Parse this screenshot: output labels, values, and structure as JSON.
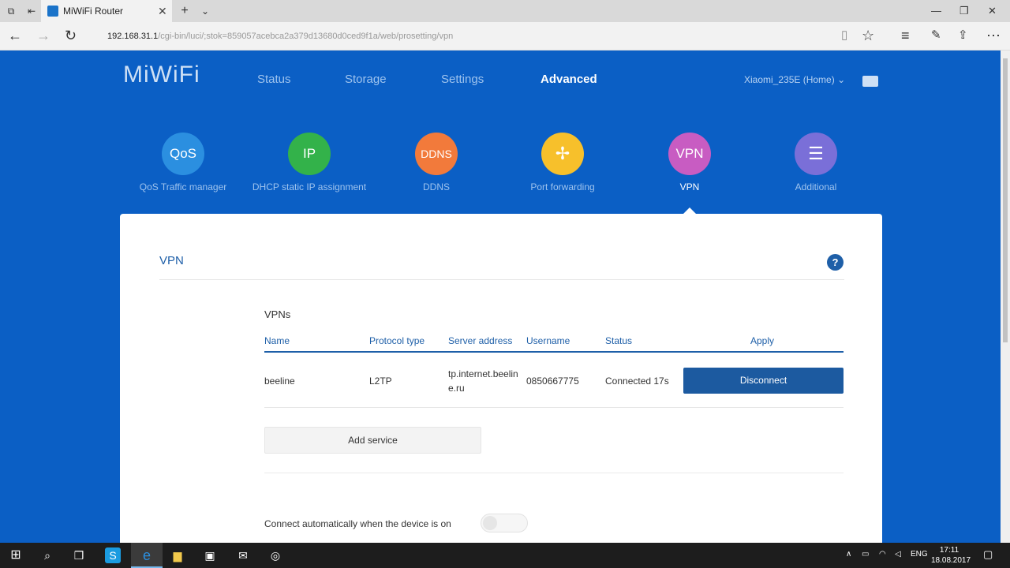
{
  "browser": {
    "tab_title": "MiWiFi Router",
    "url_host": "192.168.31.1",
    "url_path": "/cgi-bin/luci/;stok=859057acebca2a379d13680d0ced9f1a/web/prosetting/vpn"
  },
  "header": {
    "logo": "MiWiFi",
    "nav": [
      "Status",
      "Storage",
      "Settings",
      "Advanced"
    ],
    "active_nav": "Advanced",
    "router_name": "Xiaomi_235E (Home)"
  },
  "features": [
    {
      "icon_text": "QoS",
      "label": "QoS Traffic manager",
      "color": "#2b8fe0"
    },
    {
      "icon_text": "IP",
      "label": "DHCP static IP assignment",
      "color": "#33b24a"
    },
    {
      "icon_text": "DDNS",
      "label": "DDNS",
      "color": "#f27a3b"
    },
    {
      "icon_text": "",
      "label": "Port forwarding",
      "color": "#f7c02b"
    },
    {
      "icon_text": "VPN",
      "label": "VPN",
      "color": "#c85cc2"
    },
    {
      "icon_text": "☰",
      "label": "Additional",
      "color": "#7a6fd8"
    }
  ],
  "panel": {
    "title": "VPN",
    "help": "?",
    "section_title": "VPNs",
    "columns": [
      "Name",
      "Protocol type",
      "Server address",
      "Username",
      "Status",
      "Apply"
    ],
    "row": {
      "name": "beeline",
      "protocol": "L2TP",
      "server_line1": "tp.internet.beelin",
      "server_line2": "e.ru",
      "username": "0850667775",
      "status": "Connected 17s",
      "action": "Disconnect"
    },
    "add_service": "Add service",
    "auto_connect_label": "Connect automatically when the device is on",
    "auto_connect": false
  },
  "taskbar": {
    "lang": "ENG",
    "time": "17:11",
    "date": "18.08.2017"
  },
  "colors": {
    "page_bg": "#0b5fc5",
    "accent": "#1e5fa8"
  }
}
